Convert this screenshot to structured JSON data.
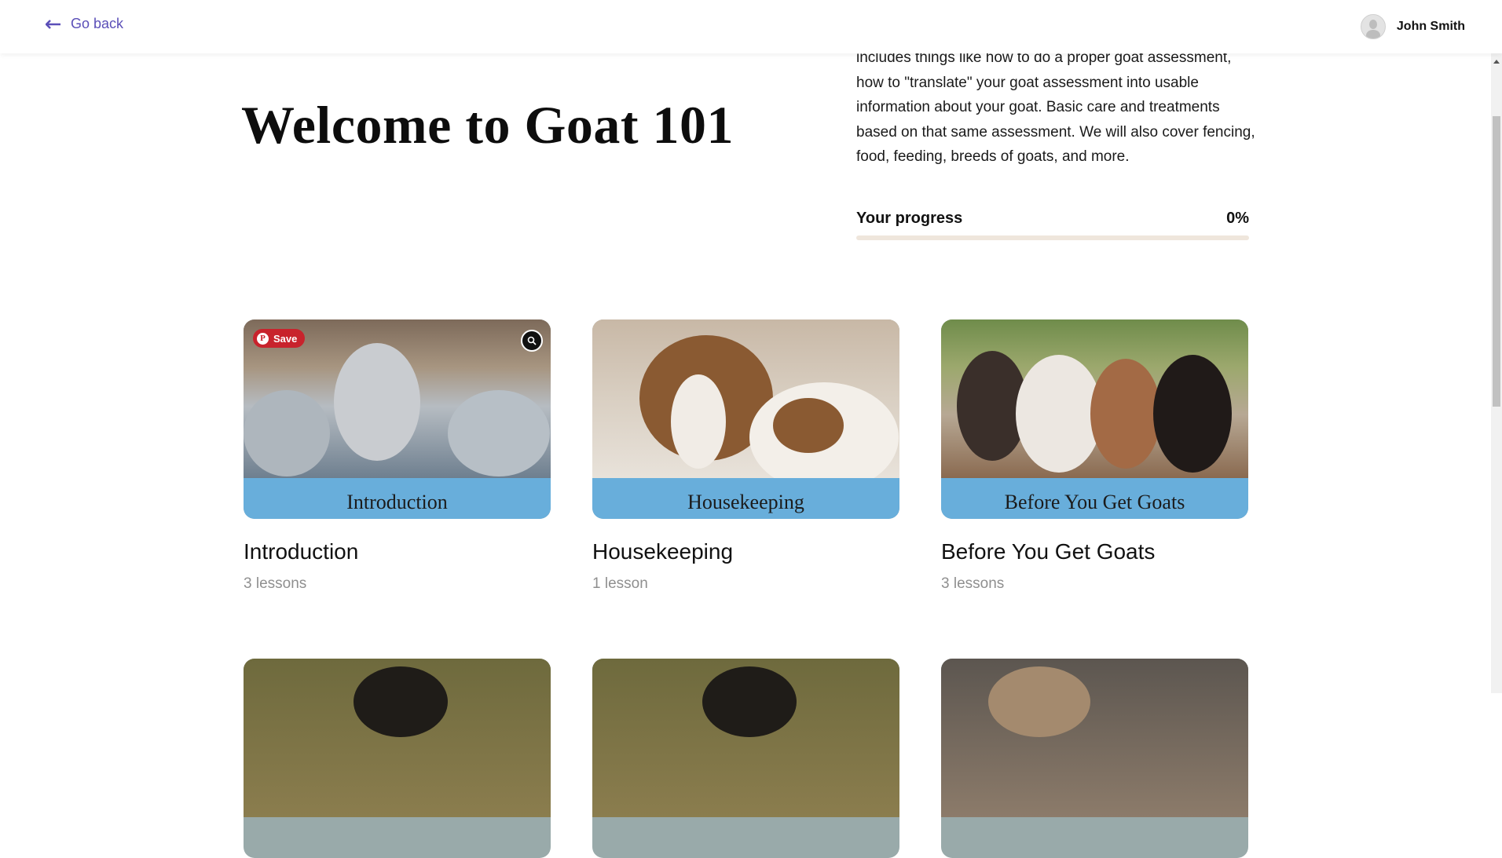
{
  "header": {
    "back_label": "Go back",
    "user_name": "John Smith"
  },
  "hero": {
    "title": "Welcome to Goat 101",
    "description": "includes things like how to do a proper goat assessment, how to \"translate\" your goat assessment into usable information about your goat. Basic care and treatments based on that same assessment. We will also cover fencing, food, feeding, breeds of goats, and more."
  },
  "progress": {
    "label": "Your progress",
    "value_text": "0%",
    "value": 0
  },
  "modules": [
    {
      "banner": "Introduction",
      "title": "Introduction",
      "lessons": "3 lessons"
    },
    {
      "banner": "Housekeeping",
      "title": "Housekeeping",
      "lessons": "1 lesson"
    },
    {
      "banner": "Before You Get Goats",
      "title": "Before You Get Goats",
      "lessons": "3 lessons"
    }
  ],
  "overlay": {
    "pin_save_label": "Save",
    "pin_icon": "P"
  },
  "colors": {
    "accent": "#5b4fb8",
    "banner": "#68aedb",
    "progress_track": "#efe6dc",
    "pinterest": "#c8232c"
  }
}
